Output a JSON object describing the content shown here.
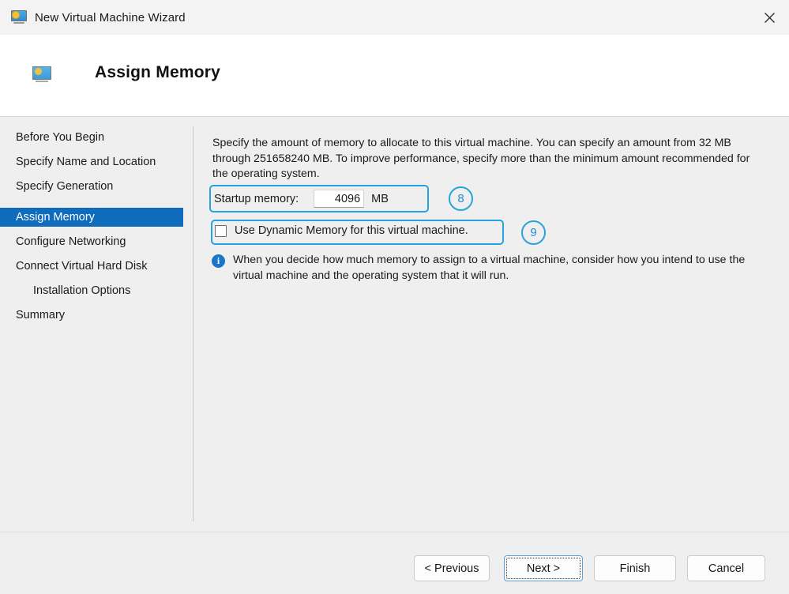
{
  "window": {
    "title": "New Virtual Machine Wizard",
    "icon": "virtual-machine-icon",
    "close_label": "✕"
  },
  "header": {
    "title": "Assign Memory",
    "icon": "virtual-machine-icon"
  },
  "sidebar": {
    "items": [
      {
        "label": "Before You Begin",
        "selected": false,
        "indented": false
      },
      {
        "label": "Specify Name and Location",
        "selected": false,
        "indented": false
      },
      {
        "label": "Specify Generation",
        "selected": false,
        "indented": false
      },
      {
        "label": "Assign Memory",
        "selected": true,
        "indented": false
      },
      {
        "label": "Configure Networking",
        "selected": false,
        "indented": false
      },
      {
        "label": "Connect Virtual Hard Disk",
        "selected": false,
        "indented": false
      },
      {
        "label": "Installation Options",
        "selected": false,
        "indented": true
      },
      {
        "label": "Summary",
        "selected": false,
        "indented": false
      }
    ],
    "selected_bg": "#0f6cbd"
  },
  "main": {
    "description": "Specify the amount of memory to allocate to this virtual machine. You can specify an amount from 32 MB through 251658240 MB. To improve performance, specify more than the minimum amount recommended for the operating system.",
    "startup_memory": {
      "label": "Startup memory:",
      "value": "4096",
      "placeholder": "",
      "unit": "MB"
    },
    "dynamic_memory": {
      "label": "Use Dynamic Memory for this virtual machine.",
      "checked": false
    },
    "note": {
      "icon": "info-icon",
      "glyph": "i",
      "text": "When you decide how much memory to assign to a virtual machine, consider how you intend to use the virtual machine and the operating system that it will run."
    }
  },
  "annotations": {
    "color": "#29a3dd",
    "badges": [
      {
        "id": "badge-8",
        "label": "8",
        "target": "startup-memory-row"
      },
      {
        "id": "badge-9",
        "label": "9",
        "target": "dynamic-memory-row"
      }
    ]
  },
  "footer": {
    "buttons": [
      {
        "id": "btn-previous",
        "label": "< Previous",
        "focused": false
      },
      {
        "id": "btn-next",
        "label": "Next >",
        "focused": true
      },
      {
        "id": "btn-finish",
        "label": "Finish",
        "focused": false
      },
      {
        "id": "btn-cancel",
        "label": "Cancel",
        "focused": false
      }
    ]
  }
}
